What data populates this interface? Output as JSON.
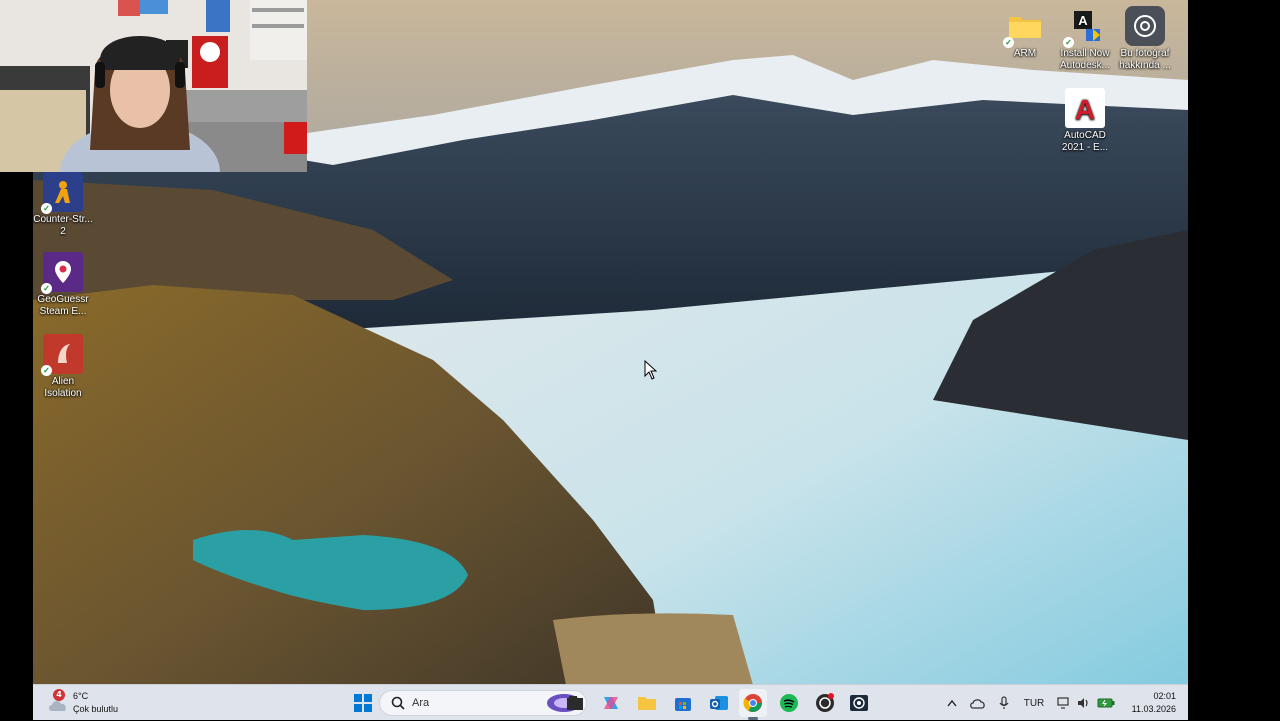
{
  "desktop": {
    "left_icons": [
      {
        "label": "Counter-Str...\n2",
        "line1": "Counter-Str...",
        "line2": "2",
        "icon": "counter-strike-icon"
      },
      {
        "line1": "GeoGuessr",
        "line2": "Steam E...",
        "icon": "geoguessr-icon"
      },
      {
        "line1": "Alien",
        "line2": "Isolation",
        "icon": "alien-isolation-icon"
      }
    ],
    "right_icons": [
      {
        "line1": "ARM",
        "line2": "",
        "icon": "folder-icon"
      },
      {
        "line1": "Install Now",
        "line2": "Autodesk...",
        "icon": "autodesk-installer-icon"
      },
      {
        "line1": "Bu fotoğraf",
        "line2": "hakkında ...",
        "icon": "camera-info-icon"
      },
      {
        "line1": "AutoCAD",
        "line2": "2021 - E...",
        "icon": "autocad-icon"
      }
    ]
  },
  "taskbar": {
    "weather": {
      "temp": "6°C",
      "condition": "Çok bulutlu",
      "badge": "4"
    },
    "search": {
      "placeholder": "Ara"
    },
    "apps": [
      "widgets-icon",
      "file-explorer-icon",
      "copilot-icon",
      "folder-icon",
      "store-icon",
      "outlook-icon",
      "chrome-icon",
      "spotify-icon",
      "obs-icon",
      "camera-app-icon"
    ],
    "tray": {
      "language": "TUR",
      "time": "02:01",
      "date": "11.03.2026"
    }
  },
  "colors": {
    "taskbar_bg": "#dfe4ec",
    "accent": "#0067c0"
  }
}
